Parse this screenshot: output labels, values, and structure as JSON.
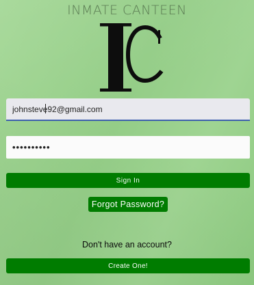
{
  "app": {
    "title": "INMATE CANTEEN",
    "logo_letters": "IC"
  },
  "form": {
    "email_value": "johnsteve92@gmail.com",
    "password_masked": "••••••••••"
  },
  "buttons": {
    "sign_in_label": "Sign In",
    "forgot_password_label": "Forgot Password?",
    "create_label": "Create One!"
  },
  "prompt": {
    "no_account_text": "Don't have an account?"
  },
  "colors": {
    "background": "#99d18c",
    "button": "#007c00",
    "title": "#5a7a52",
    "focus_underline": "#3d5fae"
  },
  "icons": {
    "logo": "ic-monogram-logo"
  }
}
